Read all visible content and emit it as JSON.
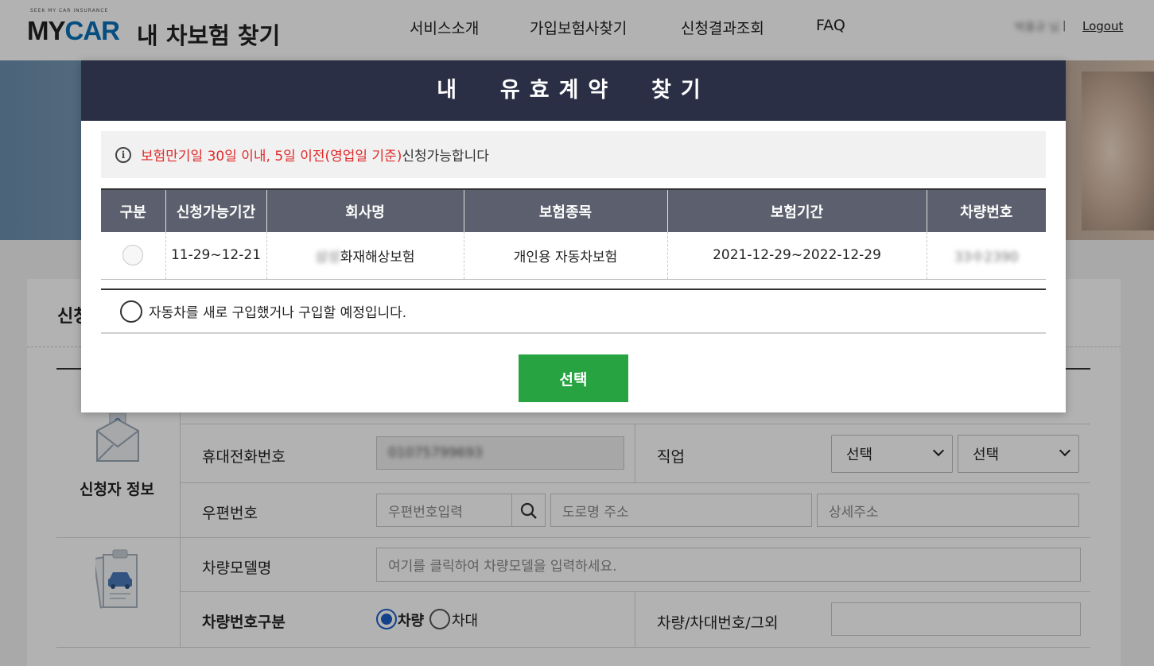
{
  "header": {
    "logo_tagline": "SEEK MY CAR INSURANCE",
    "logo_my": "MY",
    "logo_car": "CAR",
    "logo_title": "내 차보험 찾기",
    "nav": [
      "서비스소개",
      "가입보험사찾기",
      "신청결과조회",
      "FAQ"
    ],
    "user_name": "박홍규 님",
    "logout": "Logout"
  },
  "page": {
    "section_title": "신청",
    "applicant_label": "신청자 정보",
    "phone_label": "휴대전화번호",
    "phone_value": "01075799693",
    "job_label": "직업",
    "job_select_1": "선택",
    "job_select_2": "선택",
    "postal_label": "우편번호",
    "postal_placeholder": "우편번호입력",
    "road_placeholder": "도로명 주소",
    "detail_placeholder": "상세주소",
    "model_label": "차량모델명",
    "model_placeholder": "여기를 클릭하여 차량모델을 입력하세요.",
    "plate_type_label": "차량번호구분",
    "plate_type_vehicle": "차량",
    "plate_type_chassis": "차대",
    "plate_number_label": "차량/차대번호/그외"
  },
  "modal": {
    "title": "내  유효계약  찾기",
    "notice_red": "보험만기일 30일 이내, 5일 이전(영업일 기준)",
    "notice_rest": " 신청가능합니다",
    "columns": [
      "구분",
      "신청가능기간",
      "회사명",
      "보험종목",
      "보험기간",
      "차량번호"
    ],
    "row": {
      "period": "11-29~12-21",
      "company_hidden": "삼성",
      "company": "화재해상보험",
      "product": "개인용 자동차보험",
      "term": "2021-12-29~2022-12-29",
      "plate": "33수2390"
    },
    "new_car_option": "자동차를 새로 구입했거나 구입할 예정입니다.",
    "select_button": "선택"
  }
}
